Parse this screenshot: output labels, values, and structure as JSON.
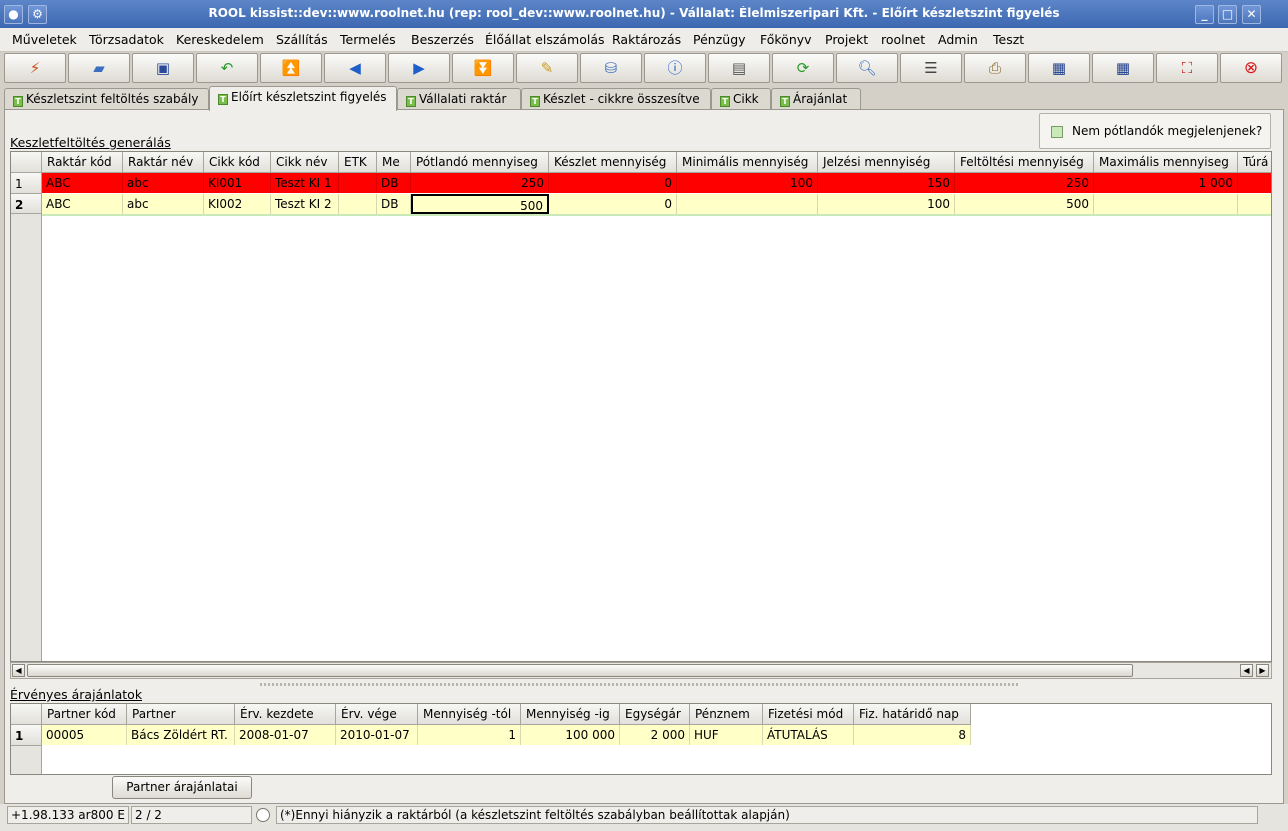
{
  "window": {
    "title": "ROOL kissist::dev::www.roolnet.hu (rep: rool_dev::www.roolnet.hu) - Vállalat: Élelmiszeripari Kft. - Előírt készletszint figyelés"
  },
  "menu": [
    "Műveletek",
    "Törzsadatok",
    "Kereskedelem",
    "Szállítás",
    "Termelés",
    "Beszerzés",
    "Élőállat elszámolás",
    "Raktározás",
    "Pénzügy",
    "Főkönyv",
    "Projekt",
    "roolnet",
    "Admin",
    "Teszt"
  ],
  "toolbar_icons": [
    "wand-icon",
    "open-folder-icon",
    "save-icon",
    "refresh-back-icon",
    "first-record-icon",
    "previous-icon",
    "next-icon",
    "last-record-icon",
    "edit-icon",
    "database-icon",
    "info-icon",
    "layout-icon",
    "reload-icon",
    "search-icon",
    "columns-icon",
    "print-icon",
    "grid-export-icon",
    "grid-import-icon",
    "fullscreen-icon",
    "close-icon"
  ],
  "tabs": [
    "Készletszint feltöltés szabály",
    "Előírt készletszint figyelés",
    "Vállalati raktár",
    "Készlet - cikkre összesítve",
    "Cikk",
    "Árajánlat"
  ],
  "upper": {
    "section_label": "Keszletfeltöltés generálás",
    "checkbox_label": "Nem pótlandók megjelenjenek?",
    "columns": [
      "Raktár kód",
      "Raktár név",
      "Cikk kód",
      "Cikk név",
      "ETK",
      "Me",
      "Pótlandó mennyiseg",
      "Készlet mennyiség",
      "Minimális mennyiség",
      "Jelzési mennyiség",
      "Feltöltési mennyiség",
      "Maximális mennyiseg",
      "Túrá"
    ],
    "rows": [
      {
        "num": "1",
        "cells": [
          "ABC",
          "abc",
          "KI001",
          "Teszt KI 1",
          "",
          "DB",
          "250",
          "0",
          "100",
          "150",
          "250",
          "1 000",
          ""
        ]
      },
      {
        "num": "2",
        "cells": [
          "ABC",
          "abc",
          "KI002",
          "Teszt KI 2",
          "",
          "DB",
          "500",
          "0",
          "",
          "100",
          "500",
          "",
          ""
        ]
      }
    ]
  },
  "lower": {
    "section_label": "Érvényes árajánlatok",
    "columns": [
      "Partner kód",
      "Partner",
      "Érv. kezdete",
      "Érv. vége",
      "Mennyiség -tól",
      "Mennyiség -ig",
      "Egységár",
      "Pénznem",
      "Fizetési mód",
      "Fiz. határidő nap"
    ],
    "rows": [
      {
        "num": "1",
        "cells": [
          "00005",
          "Bács Zöldért RT.",
          "2008-01-07",
          "2010-01-07",
          "1",
          "100 000",
          "2 000",
          "HUF",
          "ÁTUTALÁS",
          "8"
        ]
      }
    ],
    "button_label": "Partner árajánlatai"
  },
  "status": {
    "version": "+1.98.133 ar800 E",
    "record": "2 / 2",
    "message": "(*)Ennyi hiányzik a raktárból (a készletszint feltöltés szabályban beállítottak alapján)"
  }
}
